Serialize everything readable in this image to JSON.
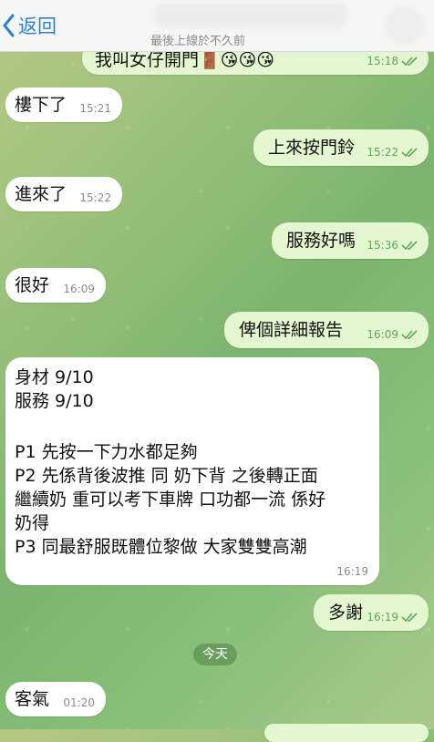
{
  "header": {
    "back_label": "返回",
    "last_seen": "最後上線於不久前"
  },
  "messages": [
    {
      "id": "m0",
      "side": "out",
      "text": "我叫女仔開門🚪😘😘😘",
      "time": "15:18",
      "read": true
    },
    {
      "id": "m1",
      "side": "in",
      "text": "樓下了",
      "time": "15:21"
    },
    {
      "id": "m2",
      "side": "out",
      "text": "上來按門鈴",
      "time": "15:22",
      "read": true
    },
    {
      "id": "m3",
      "side": "in",
      "text": "進來了",
      "time": "15:22"
    },
    {
      "id": "m4",
      "side": "out",
      "text": "服務好嗎",
      "time": "15:36",
      "read": true
    },
    {
      "id": "m5",
      "side": "in",
      "text": "很好",
      "time": "16:09"
    },
    {
      "id": "m6",
      "side": "out",
      "text": "俾個詳細報告",
      "time": "16:09",
      "read": true
    },
    {
      "id": "m7",
      "side": "in",
      "lines": [
        "身材 9/10",
        "服務 9/10",
        "",
        "P1 先按一下力水都足夠",
        "P2 先係背後波推 同 奶下背 之後轉正面",
        "繼續奶 重可以考下車牌 口功都一流 係好",
        "奶得",
        "P3 同最舒服既體位黎做 大家雙雙高潮"
      ],
      "time": "16:19"
    },
    {
      "id": "m8",
      "side": "out",
      "text": "多謝",
      "time": "16:19",
      "read": true
    },
    {
      "id": "m9",
      "side": "in",
      "text": "客氣",
      "time": "01:20"
    }
  ],
  "date_separator": "今天",
  "colors": {
    "accent": "#2f7fd6",
    "incoming_bubble": "#ffffff",
    "outgoing_bubble": "#e5f7d0",
    "read_check": "#5fa756"
  },
  "icons": {
    "back": "chevron-left-icon",
    "read": "double-check-icon"
  }
}
